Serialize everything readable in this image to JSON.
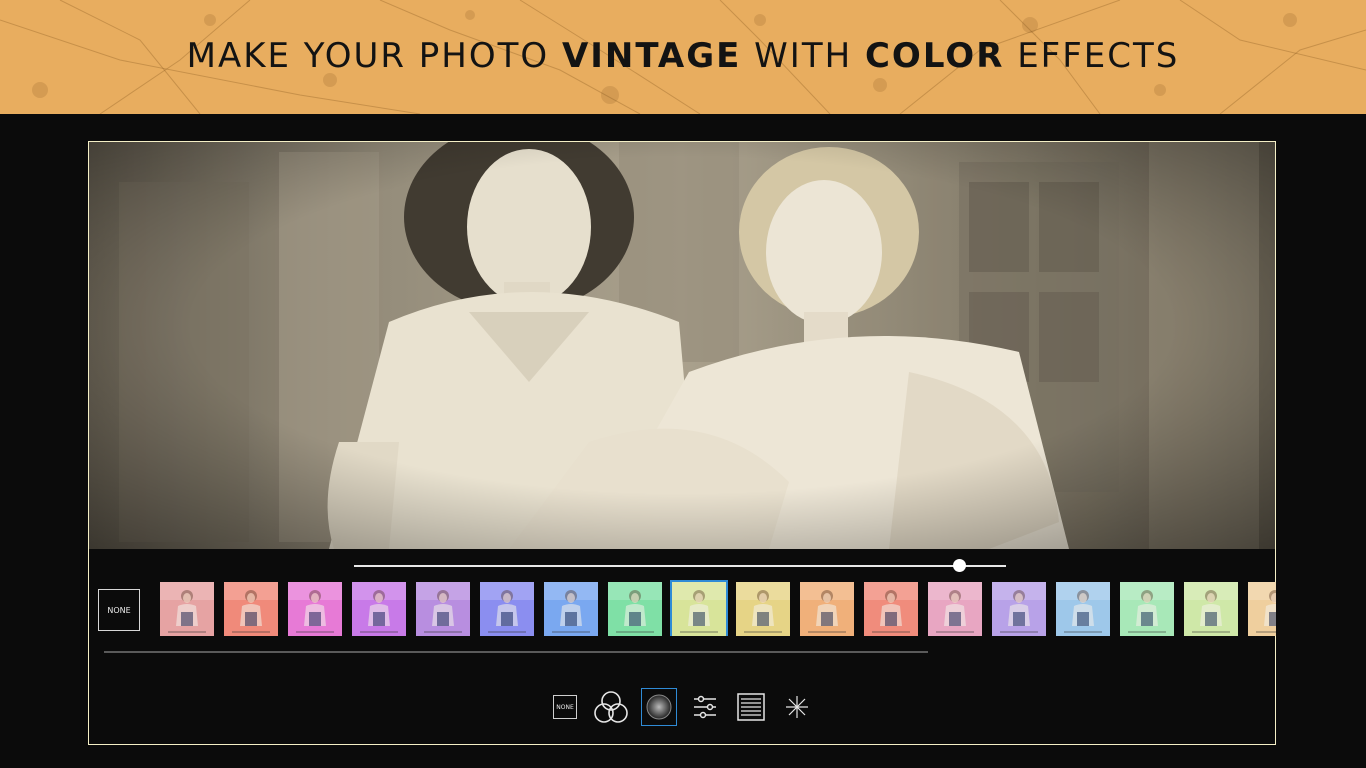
{
  "banner": {
    "part1": "MAKE YOUR PHOTO ",
    "bold1": "VINTAGE",
    "part2": " WITH ",
    "bold2": "COLOR",
    "part3": " EFFECTS",
    "background": "#e8ad5f"
  },
  "editor": {
    "intensity_value": 0.93,
    "none_label": "NONE",
    "selected_filter_index": 8,
    "accent_color": "#2f8bd6",
    "filters": [
      {
        "tint": "#e6a3a3"
      },
      {
        "tint": "#f08a7a"
      },
      {
        "tint": "#e77ad6"
      },
      {
        "tint": "#c97ae8"
      },
      {
        "tint": "#b88ee0"
      },
      {
        "tint": "#8b8ef0"
      },
      {
        "tint": "#7aa8f0"
      },
      {
        "tint": "#7fe0a6"
      },
      {
        "tint": "#d8e59a"
      },
      {
        "tint": "#e6d586"
      },
      {
        "tint": "#f0b07a"
      },
      {
        "tint": "#f08c7c"
      },
      {
        "tint": "#e8a6c2"
      },
      {
        "tint": "#b9a2e8"
      },
      {
        "tint": "#9ec8ea"
      },
      {
        "tint": "#a9e8b8"
      },
      {
        "tint": "#cfe9a8"
      },
      {
        "tint": "#efcf9e"
      }
    ]
  },
  "toolbar": {
    "none_label": "NONE",
    "tools": [
      {
        "name": "none-filter-icon"
      },
      {
        "name": "color-circles-icon"
      },
      {
        "name": "vignette-icon"
      },
      {
        "name": "adjust-sliders-icon"
      },
      {
        "name": "texture-lines-icon"
      },
      {
        "name": "sparkle-icon"
      }
    ]
  }
}
